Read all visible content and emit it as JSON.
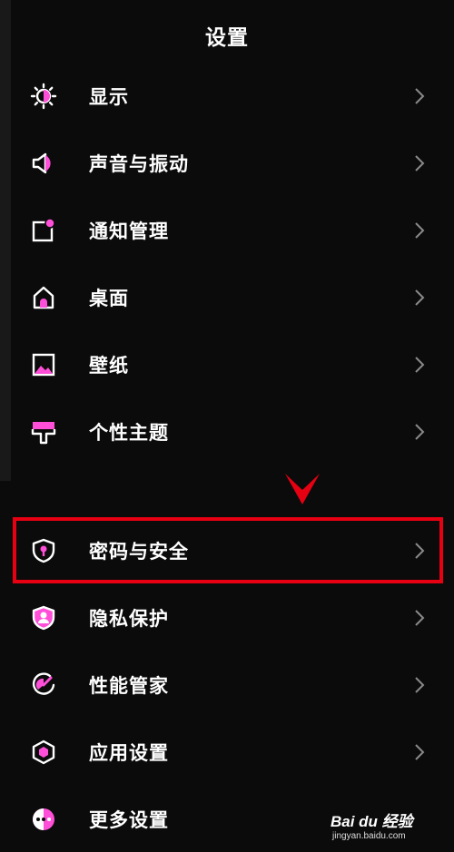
{
  "header": {
    "title": "设置"
  },
  "menu": [
    {
      "label": "显示",
      "icon": "brightness-icon"
    },
    {
      "label": "声音与振动",
      "icon": "speaker-icon"
    },
    {
      "label": "通知管理",
      "icon": "notification-icon"
    },
    {
      "label": "桌面",
      "icon": "home-icon"
    },
    {
      "label": "壁纸",
      "icon": "wallpaper-icon"
    },
    {
      "label": "个性主题",
      "icon": "theme-icon"
    },
    {
      "label": "密码与安全",
      "icon": "shield-lock-icon"
    },
    {
      "label": "隐私保护",
      "icon": "privacy-icon"
    },
    {
      "label": "性能管家",
      "icon": "gauge-icon"
    },
    {
      "label": "应用设置",
      "icon": "hexagon-icon"
    },
    {
      "label": "更多设置",
      "icon": "more-icon"
    }
  ],
  "annotation": {
    "color": "#e60012"
  },
  "watermark": {
    "brand": "Bai du 经验",
    "url": "jingyan.baidu.com"
  },
  "colors": {
    "accent": "#ff4fd8",
    "background": "#0b0b0b",
    "text": "#ffffff",
    "chevron": "#8a8a8a"
  }
}
